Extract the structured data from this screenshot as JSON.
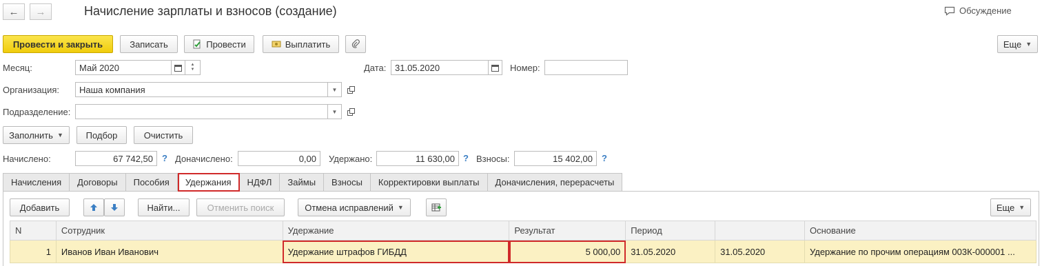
{
  "header": {
    "title": "Начисление зарплаты и взносов (создание)",
    "discussion_label": "Обсуждение"
  },
  "toolbar": {
    "post_close_label": "Провести и закрыть",
    "save_label": "Записать",
    "post_label": "Провести",
    "pay_label": "Выплатить",
    "more_label": "Еще"
  },
  "form": {
    "month_label": "Месяц:",
    "month_value": "Май 2020",
    "date_label": "Дата:",
    "date_value": "31.05.2020",
    "number_label": "Номер:",
    "number_value": "",
    "org_label": "Организация:",
    "org_value": "Наша компания",
    "dept_label": "Подразделение:",
    "dept_value": ""
  },
  "actions": {
    "fill_label": "Заполнить",
    "select_label": "Подбор",
    "clear_label": "Очистить"
  },
  "totals": {
    "accrued_label": "Начислено:",
    "accrued_value": "67 742,50",
    "additional_label": "Доначислено:",
    "additional_value": "0,00",
    "withheld_label": "Удержано:",
    "withheld_value": "11 630,00",
    "contributions_label": "Взносы:",
    "contributions_value": "15 402,00",
    "help": "?"
  },
  "tabs": [
    "Начисления",
    "Договоры",
    "Пособия",
    "Удержания",
    "НДФЛ",
    "Займы",
    "Взносы",
    "Корректировки выплаты",
    "Доначисления, перерасчеты"
  ],
  "grid_toolbar": {
    "add_label": "Добавить",
    "find_label": "Найти...",
    "cancel_search_label": "Отменить поиск",
    "cancel_fix_label": "Отмена исправлений",
    "more_label": "Еще"
  },
  "table": {
    "headers": [
      "N",
      "Сотрудник",
      "Удержание",
      "Результат",
      "Период",
      "",
      "Основание"
    ],
    "rows": [
      [
        "1",
        "Иванов Иван Иванович",
        "Удержание штрафов ГИБДД",
        "5 000,00",
        "31.05.2020",
        "31.05.2020",
        "Удержание по прочим операциям 003К-000001 ..."
      ]
    ]
  },
  "colors": {
    "primary_button": "#f5d61c",
    "highlight": "#d02a2a",
    "selected_row": "#fbf1c3",
    "help_icon": "#3b7fc4"
  }
}
